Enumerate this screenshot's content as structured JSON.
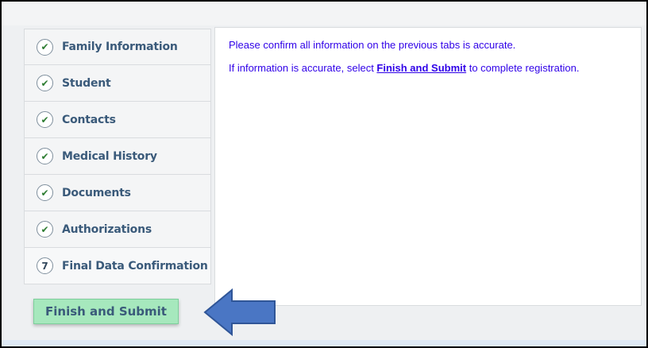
{
  "steps": [
    {
      "label": "Family Information",
      "status": "done",
      "icon": "check-icon"
    },
    {
      "label": "Student",
      "status": "done",
      "icon": "check-icon"
    },
    {
      "label": "Contacts",
      "status": "done",
      "icon": "check-icon"
    },
    {
      "label": "Medical History",
      "status": "done",
      "icon": "check-icon"
    },
    {
      "label": "Documents",
      "status": "done",
      "icon": "check-icon"
    },
    {
      "label": "Authorizations",
      "status": "done",
      "icon": "check-icon"
    },
    {
      "label": "Final Data Confirmation",
      "status": "current",
      "number": "7"
    }
  ],
  "content": {
    "line1": "Please confirm all information on the previous tabs is accurate.",
    "line2_before": "If information is accurate, select ",
    "line2_link": "Finish and Submit",
    "line2_after": " to complete registration."
  },
  "finish_button": {
    "label": "Finish and Submit"
  },
  "colors": {
    "text_blue": "#2f00e8",
    "button_green": "#a6e8bd",
    "arrow_blue": "#4a76c4",
    "check_green": "#2e7d32"
  }
}
